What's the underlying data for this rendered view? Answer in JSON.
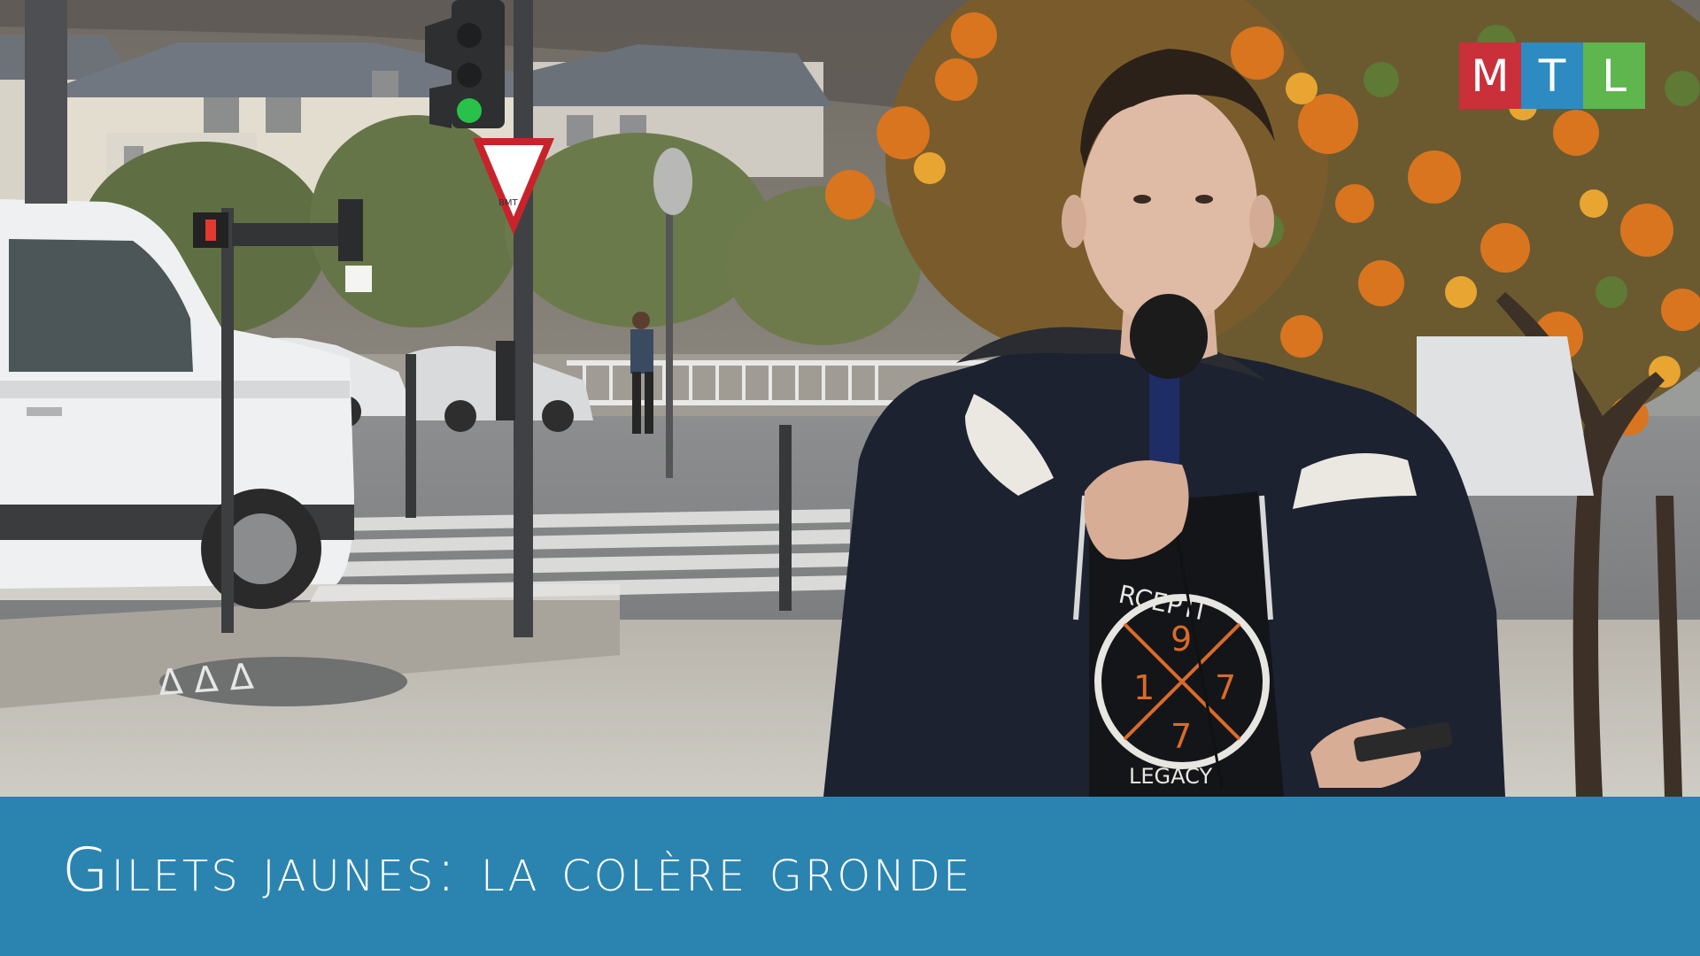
{
  "logo": {
    "letters": [
      {
        "char": "M",
        "color": "#c9303a"
      },
      {
        "char": "T",
        "color": "#2d8bc2"
      },
      {
        "char": "L",
        "color": "#5fb54e"
      }
    ]
  },
  "lower_third": {
    "headline": "Gilets jaunes: la colère gronde",
    "background": "#2b84b0"
  },
  "shirt": {
    "print_top": "RCEPTI",
    "print_mid": "9",
    "print_left": "1",
    "print_right": "7",
    "print_low": "7",
    "print_bottom": "LEGACY"
  },
  "scene": {
    "sign_text": "BMT"
  }
}
